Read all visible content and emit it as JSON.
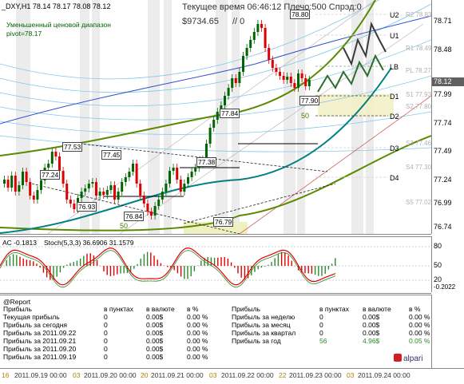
{
  "header": {
    "symbol_line": "_DXY,H1  78.14 78.17 78.08 78.12",
    "info_line": "Текущее время 06:46:12 Плечо:500 Спрэд:0",
    "balance": "$9734.65",
    "positions": "// 0",
    "range_label": "Уменьшенный ценовой диапазон",
    "pivot_label": "pivot=78.17"
  },
  "levels": {
    "U2": "U2",
    "U1": "U1",
    "LB": "LB",
    "D1": "D1",
    "D2": "D2",
    "D3": "D3",
    "D4": "D4"
  },
  "pivot_labels": [
    "R2 78.83",
    "R1 78.49",
    "PL 78.27",
    "S1 77.93",
    "S2 77.80",
    "S3 77.46",
    "S4 77.30",
    "S5 77.02"
  ],
  "price_labels": [
    "78.80",
    "77.84",
    "77.90",
    "77.53",
    "77.45",
    "77.38",
    "77.24",
    "76.93",
    "76.84",
    "76.79"
  ],
  "misc_labels": [
    "50",
    "50"
  ],
  "price_scale": [
    "78.71",
    "78.48",
    "78.12",
    "77.99",
    "77.74",
    "77.49",
    "77.24",
    "76.99",
    "76.74"
  ],
  "current_price": "78.12",
  "osc": {
    "indicator_label": "AC -0.1813",
    "stoch_label": "Stoch(5,3,3) 36.6906 31.1579",
    "scale": [
      "80",
      "50",
      "20",
      "-0.2022"
    ]
  },
  "report": {
    "title": "@Report",
    "left_headers": [
      "Прибыль",
      "в пунктах",
      "в валюте",
      "в %"
    ],
    "right_headers": [
      "Прибыль",
      "в пунктах",
      "в валюте",
      "в %"
    ],
    "left_rows": [
      {
        "name": "Текущая прибыль",
        "points": "0",
        "money": "0.00$",
        "pct": "0.00 %"
      },
      {
        "name": "Прибыль за сегодня",
        "points": "0",
        "money": "0.00$",
        "pct": "0.00 %"
      },
      {
        "name": "Прибыль за 2011.09.22",
        "points": "0",
        "money": "0.00$",
        "pct": "0.00 %"
      },
      {
        "name": "Прибыль за 2011.09.21",
        "points": "0",
        "money": "0.00$",
        "pct": "0.00 %"
      },
      {
        "name": "Прибыль за 2011.09.20",
        "points": "0",
        "money": "0.00$",
        "pct": "0.00 %"
      },
      {
        "name": "Прибыль за 2011.09.19",
        "points": "0",
        "money": "0.00$",
        "pct": "0.00 %"
      }
    ],
    "right_rows": [
      {
        "name": "Прибыль за неделю",
        "points": "0",
        "money": "0.00$",
        "pct": "0.00 %"
      },
      {
        "name": "Прибыль за месяц",
        "points": "0",
        "money": "0.00$",
        "pct": "0.00 %"
      },
      {
        "name": "Прибыль за квартал",
        "points": "0",
        "money": "0.00$",
        "pct": "0.00 %"
      },
      {
        "name": "Прибыль за год",
        "points": "56",
        "money": "4.96$",
        "pct": "0.05 %"
      }
    ],
    "brand": "alpari"
  },
  "time_axis": [
    "16",
    "2011.09.19 00:00",
    "03",
    "2011.09.20 00:00",
    "20",
    "2011.09.21 00:00",
    "03",
    "2011.09.22 00:00",
    "22",
    "2011.09.23 00:00",
    "03",
    "2011.09.24 00:00"
  ],
  "colors": {
    "bull": "#006400",
    "bear": "#dd0000",
    "channel_outer": "#5a8a00",
    "channel_mid": "#008080",
    "blue_band": "#3050d0",
    "sky_band": "#80c8e8",
    "current_tag": "#606060"
  }
}
